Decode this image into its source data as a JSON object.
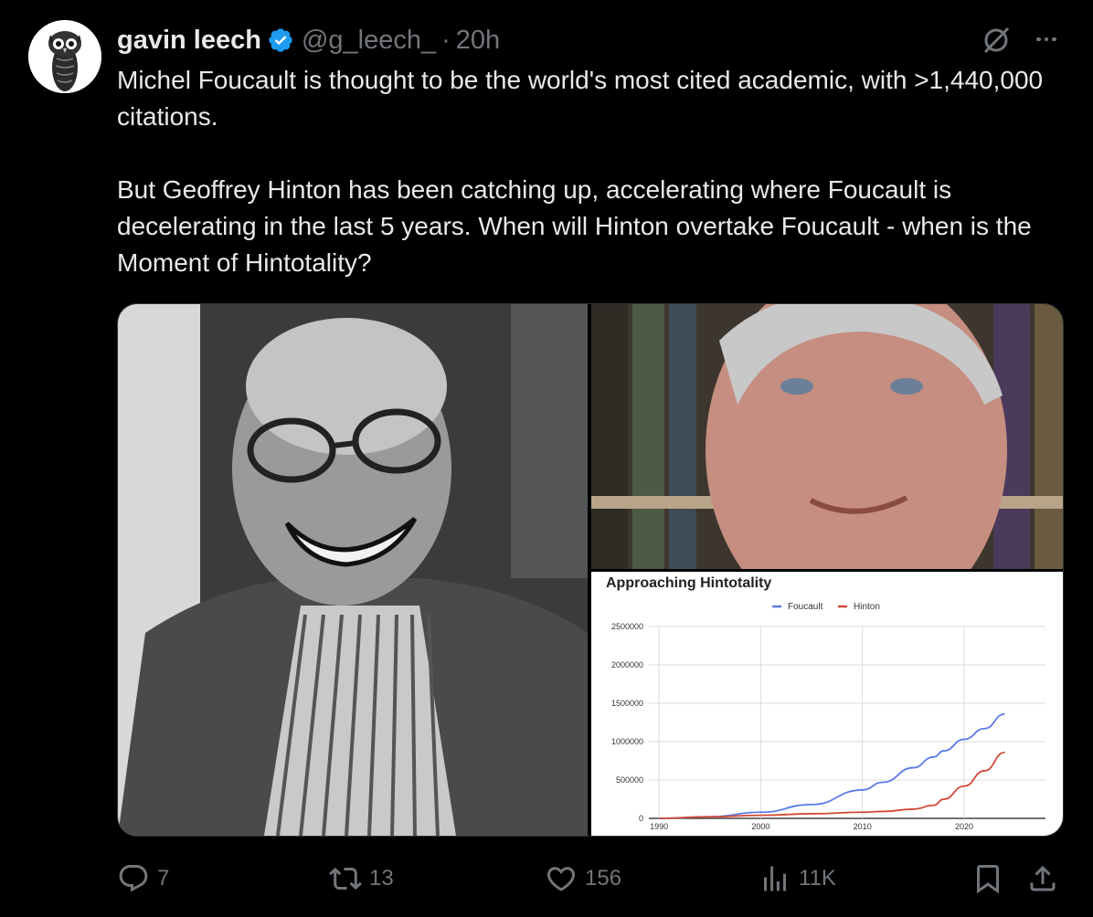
{
  "author": {
    "name": "gavin leech",
    "handle": "@g_leech_",
    "separator": "·",
    "time": "20h",
    "verified": true,
    "verified_color": "#1d9bf0"
  },
  "tweet": {
    "paragraphs": [
      "Michel Foucault is thought to be the world's most cited academic, with >1,440,000 citations.",
      "But Geoffrey Hinton has been catching up, accelerating where Foucault is decelerating in the last 5 years. When will Hinton overtake Foucault - when is the Moment of Hintotality?"
    ]
  },
  "media": {
    "images": [
      {
        "name": "foucault-photo",
        "icon": "photo-of-man-laughing-with-glasses"
      },
      {
        "name": "hinton-photo",
        "icon": "photo-of-man-smiling-in-front-of-bookshelf"
      }
    ]
  },
  "chart_data": {
    "type": "line",
    "title": "Approaching Hintotality",
    "legend_position": "top-center",
    "grid": true,
    "x": [
      1990,
      1995,
      2000,
      2005,
      2010,
      2012,
      2015,
      2017,
      2018,
      2020,
      2022,
      2024
    ],
    "xticks": [
      1990,
      2000,
      2010,
      2020
    ],
    "yticks": [
      "0",
      "500000",
      "1000000",
      "1500000",
      "2000000",
      "2500000"
    ],
    "ylim": [
      0,
      2500000
    ],
    "xlim": [
      1989,
      2028
    ],
    "series": [
      {
        "name": "Foucault",
        "color": "#5b7be7",
        "values": [
          0,
          20000,
          80000,
          180000,
          370000,
          470000,
          660000,
          800000,
          880000,
          1030000,
          1170000,
          1360000
        ]
      },
      {
        "name": "Hinton",
        "color": "#d24a36",
        "values": [
          0,
          20000,
          40000,
          60000,
          80000,
          90000,
          120000,
          170000,
          250000,
          420000,
          620000,
          860000
        ]
      }
    ]
  },
  "actions": {
    "replies": "7",
    "retweets": "13",
    "likes": "156",
    "views": "11K",
    "icon_color": "#71767b"
  }
}
